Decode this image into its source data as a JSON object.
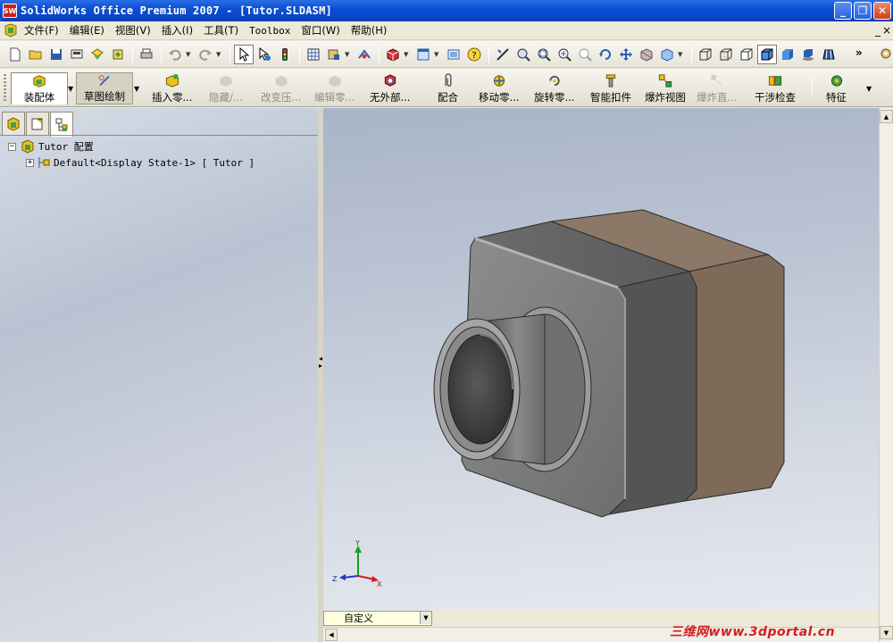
{
  "window": {
    "title": "SolidWorks Office Premium 2007 - [Tutor.SLDASM]",
    "app_icon": "SW"
  },
  "menubar": {
    "items": [
      {
        "label": "文件(F)"
      },
      {
        "label": "编辑(E)"
      },
      {
        "label": "视图(V)"
      },
      {
        "label": "插入(I)"
      },
      {
        "label": "工具(T)"
      },
      {
        "label": "Toolbox"
      },
      {
        "label": "窗口(W)"
      },
      {
        "label": "帮助(H)"
      }
    ],
    "right_minimize": "_",
    "right_close": "×"
  },
  "toolbar": {
    "overflow": "»",
    "icons": [
      "new-document-icon",
      "open-folder-icon",
      "save-icon",
      "print-preview-icon",
      "options-icon",
      "rebuild-icon",
      "printer-icon",
      "undo-icon",
      "redo-icon",
      "select-arrow-icon",
      "select-other-icon",
      "traffic-light-icon",
      "grid-icon",
      "snap-icon",
      "toggle-icon",
      "3d-box-icon",
      "view-orientation-icon",
      "layers-icon",
      "help-icon",
      "smart-dimension-icon",
      "zoom-to-fit-icon",
      "zoom-to-area-icon",
      "zoom-in-out-icon",
      "zoom-selection-icon",
      "rotate-view-icon",
      "pan-icon",
      "section-view-icon",
      "view-display-icon",
      "wireframe-icon",
      "hidden-lines-visible-icon",
      "hidden-lines-removed-icon",
      "shaded-icon",
      "shaded-with-edges-icon",
      "shadows-icon",
      "perspective-icon"
    ]
  },
  "command_manager": {
    "tabs": [
      {
        "label": "装配体"
      },
      {
        "label": "草图绘制"
      }
    ],
    "commands": [
      {
        "label": "插入零..."
      },
      {
        "label": "隐藏/..."
      },
      {
        "label": "改变压..."
      },
      {
        "label": "编辑零..."
      },
      {
        "label": "无外部..."
      },
      {
        "label": "配合"
      },
      {
        "label": "移动零..."
      },
      {
        "label": "旋转零..."
      },
      {
        "label": "智能扣件"
      },
      {
        "label": "爆炸视图"
      },
      {
        "label": "爆炸直..."
      },
      {
        "label": "干涉检查"
      },
      {
        "label": "特征"
      }
    ]
  },
  "feature_tree": {
    "root": "Tutor 配置",
    "child": "Default<Display State-1> [ Tutor ]",
    "root_expander": "−",
    "child_expander": "+"
  },
  "viewport": {
    "triad": {
      "x": "X",
      "y": "Y",
      "z": "Z"
    }
  },
  "bottom": {
    "config_value": "自定义"
  },
  "watermark": "三维网www.3dportal.cn",
  "colors": {
    "titlebar": "#0a4fd4",
    "model_gray": "#7a7a7a",
    "model_brown": "#8c7866",
    "viewport_top": "#a9b4c8",
    "viewport_bottom": "#e6e9ef"
  }
}
